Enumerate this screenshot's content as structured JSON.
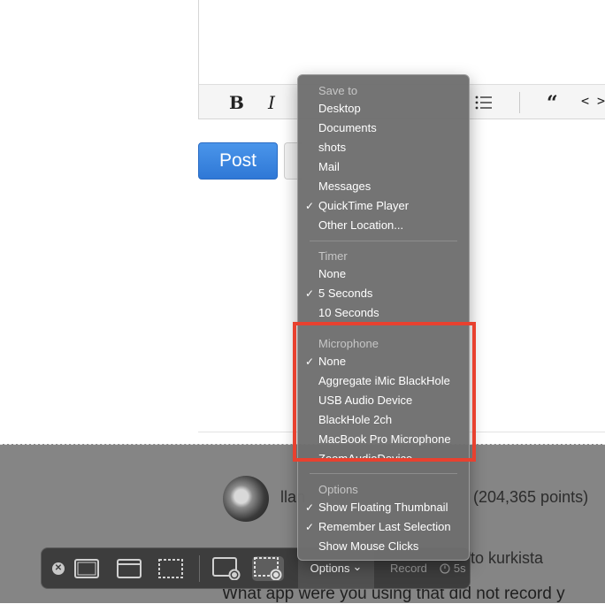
{
  "post_button": {
    "label": "Post"
  },
  "editor_toolbar": {
    "bold_icon": "bold-icon",
    "italic_icon": "italic-icon",
    "list_icon": "bulleted-list-icon",
    "quote_icon": "quote-icon",
    "code_icon": "code-icon",
    "bold_glyph": "B",
    "italic_glyph": "I",
    "quote_glyph": "“",
    "code_glyph": "< >"
  },
  "thread": {
    "reply_user": "llan",
    "reply_points": "(204,365 points)",
    "reply_to": "to kurkista",
    "question_text": "What app were you using that did not record y"
  },
  "menu": {
    "save_to_header": "Save to",
    "save_to_items": [
      "Desktop",
      "Documents",
      "shots",
      "Mail",
      "Messages",
      "QuickTime Player",
      "Other Location..."
    ],
    "save_to_checked": "QuickTime Player",
    "timer_header": "Timer",
    "timer_items": [
      "None",
      "5 Seconds",
      "10 Seconds"
    ],
    "timer_checked": "5 Seconds",
    "microphone_header": "Microphone",
    "microphone_items": [
      "None",
      "Aggregate iMic BlackHole",
      "USB Audio Device",
      "BlackHole 2ch",
      "MacBook Pro Microphone",
      "ZoomAudioDevice"
    ],
    "microphone_checked": "None",
    "options_header": "Options",
    "options_items": [
      "Show Floating Thumbnail",
      "Remember Last Selection",
      "Show Mouse Clicks"
    ],
    "options_checked": [
      "Show Floating Thumbnail",
      "Remember Last Selection"
    ],
    "check_glyph": "✓"
  },
  "screenshot_toolbar": {
    "close_glyph": "✕",
    "tools": [
      "capture-entire-screen-icon",
      "capture-window-icon",
      "capture-selection-icon",
      "record-entire-screen-icon",
      "record-selection-icon"
    ],
    "selected_tool": "record-selection-icon",
    "options_label": "Options",
    "options_chevron": "⌄",
    "record_label": "Record",
    "timer_label": "5s"
  },
  "colors": {
    "highlight": "#e8412f",
    "post_button": "#3a86e0"
  }
}
